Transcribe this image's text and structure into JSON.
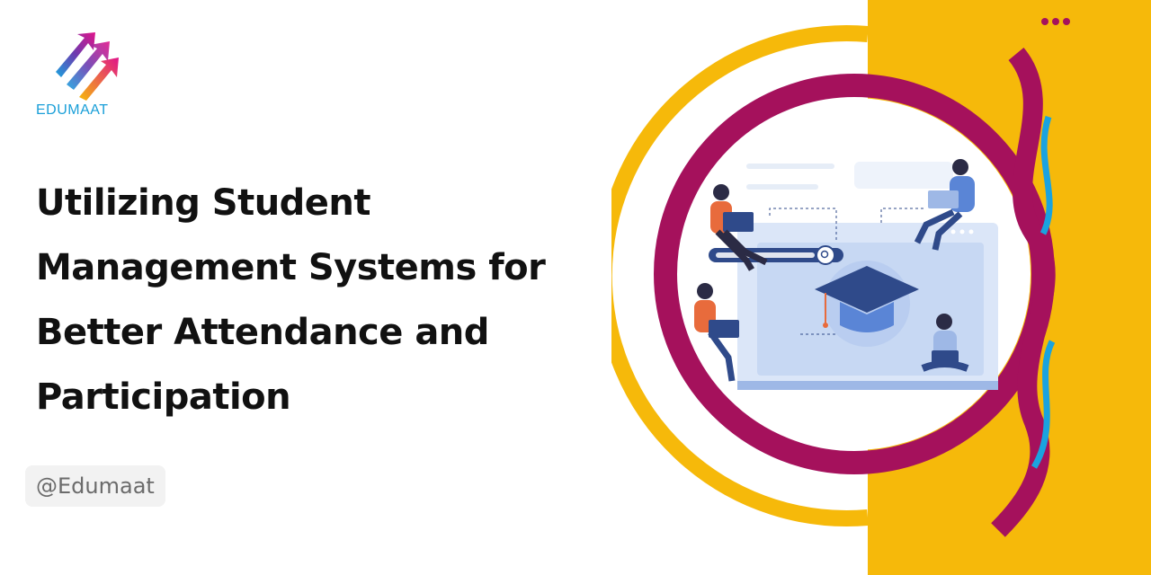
{
  "brand": {
    "logo_text": "EDUMAAT"
  },
  "headline": {
    "lines": [
      "Utilizing Student",
      "Management Systems for",
      "Better Attendance and",
      "Participation"
    ]
  },
  "handle": "@Edumaat",
  "colors": {
    "panel_yellow": "#f6b90a",
    "ring_magenta": "#a5115c",
    "accent_blue": "#1aa3df",
    "text": "#111111"
  },
  "icons": [
    "more-dots-icon",
    "graduation-cap-icon",
    "search-icon"
  ]
}
